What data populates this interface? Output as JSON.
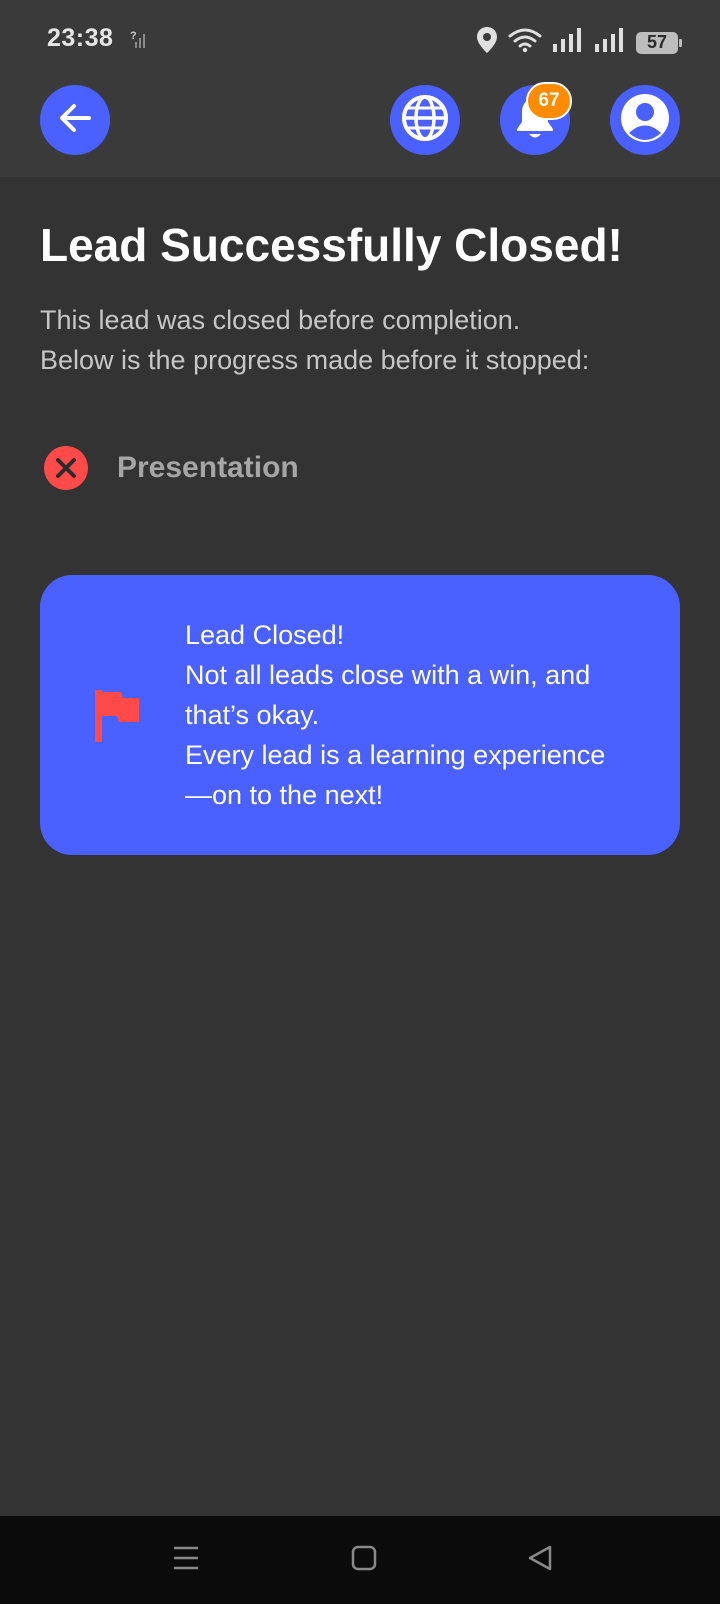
{
  "status_bar": {
    "time": "23:38",
    "battery_level": "57",
    "icons": [
      "signal-unknown-icon",
      "location-icon",
      "wifi-icon",
      "signal-icon",
      "signal-icon",
      "battery-icon"
    ]
  },
  "app_bar": {
    "icons": [
      "arrow-left-icon",
      "globe-icon",
      "bell-icon",
      "user-circle-icon"
    ],
    "notification_count": "67"
  },
  "main": {
    "title": "Lead Successfully Closed!",
    "subtitle_lines": [
      "This lead was closed before completion.",
      "Below is the progress made before it stopped:"
    ],
    "step": {
      "label": "Presentation",
      "status": "failed",
      "icon": "close-circle-icon"
    },
    "card": {
      "icon": "flag-icon",
      "lines": [
        "Lead Closed!",
        "Not all leads close with a win, and",
        "that’s okay.",
        "Every lead is a learning experience",
        "—on to the next!"
      ]
    }
  },
  "nav_bar": {
    "icons": [
      "menu-icon",
      "home-icon",
      "back-icon"
    ]
  },
  "colors": {
    "background": "#333333",
    "bar": "#3a3a3a",
    "accent": "#4a60ff",
    "badge": "#ff8c00",
    "error": "#ff4a4a"
  }
}
